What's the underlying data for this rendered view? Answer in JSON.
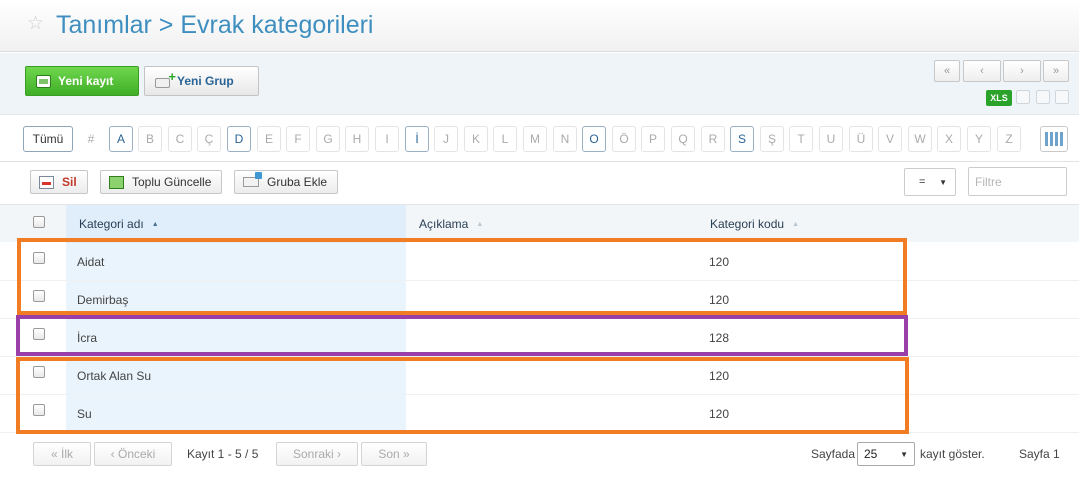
{
  "header": {
    "title": "Tanımlar > Evrak kategorileri"
  },
  "toolbar": {
    "new_record": "Yeni kayıt",
    "new_group": "Yeni Grup",
    "pager": [
      "«",
      "‹",
      "›",
      "»"
    ],
    "export_label": "XLS"
  },
  "alphabet": {
    "all_label": "Tümü",
    "letters": [
      "#",
      "A",
      "B",
      "C",
      "Ç",
      "D",
      "E",
      "F",
      "G",
      "H",
      "I",
      "İ",
      "J",
      "K",
      "L",
      "M",
      "N",
      "O",
      "Ö",
      "P",
      "Q",
      "R",
      "S",
      "Ş",
      "T",
      "U",
      "Ü",
      "V",
      "W",
      "X",
      "Y",
      "Z"
    ],
    "active_letters": [
      "A",
      "D",
      "İ",
      "O",
      "S"
    ]
  },
  "actions": {
    "delete": "Sil",
    "bulk_update": "Toplu Güncelle",
    "add_to_group": "Gruba Ekle",
    "operator": "=",
    "filter_placeholder": "Filtre"
  },
  "table": {
    "columns": [
      "Kategori adı",
      "Açıklama",
      "Kategori kodu"
    ],
    "sorted_column": "Kategori adı",
    "rows": [
      {
        "name": "Aidat",
        "description": "",
        "code": "120"
      },
      {
        "name": "Demirbaş",
        "description": "",
        "code": "120"
      },
      {
        "name": "İcra",
        "description": "",
        "code": "128"
      },
      {
        "name": "Ortak Alan Su",
        "description": "",
        "code": "120"
      },
      {
        "name": "Su",
        "description": "",
        "code": "120"
      }
    ]
  },
  "highlights": {
    "group_color": "#f17c23",
    "single_color": "#9b3fa8"
  },
  "footer": {
    "first": "« İlk",
    "prev": "‹ Önceki",
    "records": "Kayıt 1 - 5 / 5",
    "next": "Sonraki ›",
    "last": "Son »",
    "per_page_label": "Sayfada",
    "per_page_value": "25",
    "per_page_suffix": "kayıt göster.",
    "page": "Sayfa 1"
  }
}
